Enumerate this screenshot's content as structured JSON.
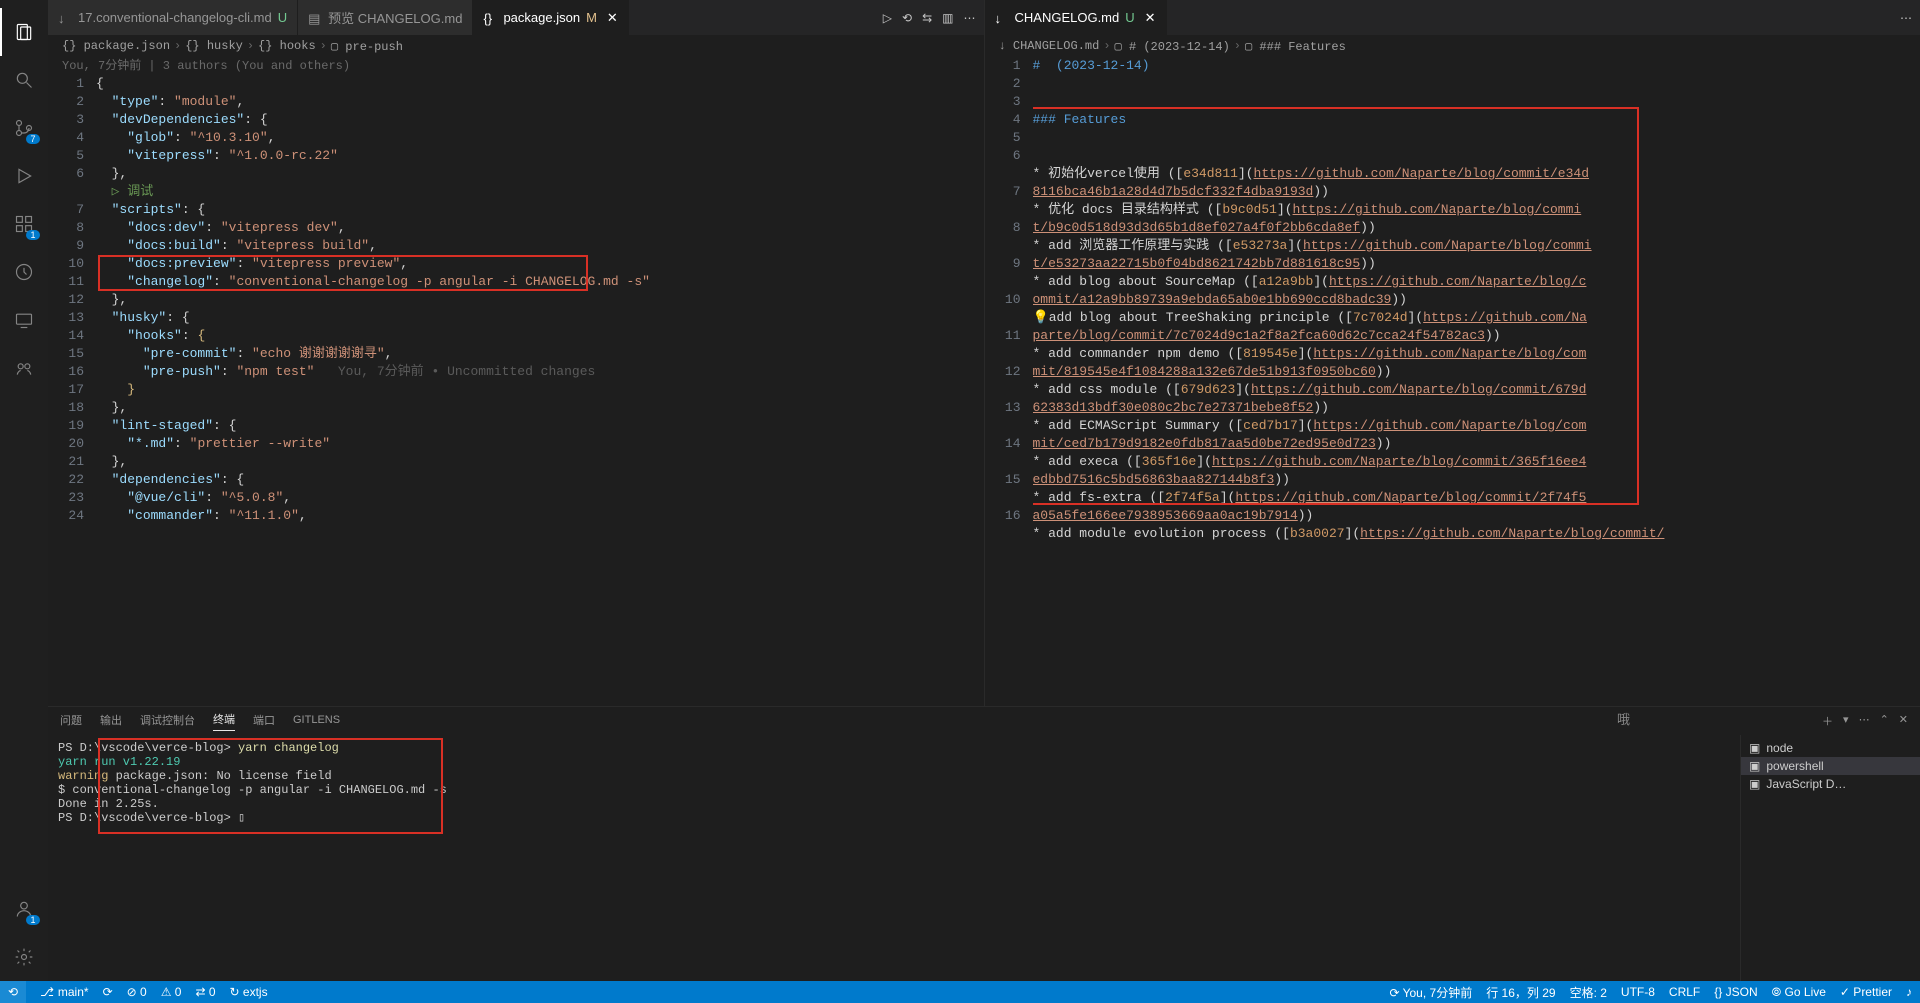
{
  "activity_badges": {
    "scm": "7",
    "extensions": "1",
    "accounts": "1"
  },
  "left_editor": {
    "tabs": [
      {
        "label": "17.conventional-changelog-cli.md",
        "status": "U",
        "icon": "↓"
      },
      {
        "label": "预览 CHANGELOG.md",
        "icon": "▤"
      },
      {
        "label": "package.json",
        "status": "M",
        "icon": "{}",
        "active": true
      }
    ],
    "breadcrumb": [
      "{} package.json",
      "{} husky",
      "{} hooks",
      "▢ pre-push"
    ],
    "blame": "You, 7分钟前 | 3 authors (You and others)",
    "code": [
      {
        "n": 1,
        "html": "<span class='tok-p'>{</span>"
      },
      {
        "n": 2,
        "html": "  <span class='tok-k'>\"type\"</span><span class='tok-p'>: </span><span class='tok-s'>\"module\"</span><span class='tok-p'>,</span>"
      },
      {
        "n": 3,
        "html": "  <span class='tok-k'>\"devDependencies\"</span><span class='tok-p'>: {</span>"
      },
      {
        "n": 4,
        "html": "    <span class='tok-k'>\"glob\"</span><span class='tok-p'>: </span><span class='tok-s'>\"^10.3.10\"</span><span class='tok-p'>,</span>"
      },
      {
        "n": 5,
        "html": "    <span class='tok-k'>\"vitepress\"</span><span class='tok-p'>: </span><span class='tok-s'>\"^1.0.0-rc.22\"</span>"
      },
      {
        "n": 6,
        "html": "  <span class='tok-p'>},</span>"
      },
      {
        "n": "",
        "html": "  <span class='tok-c'>▷ 调试</span>"
      },
      {
        "n": 7,
        "html": "  <span class='tok-k'>\"scripts\"</span><span class='tok-p'>: {</span>"
      },
      {
        "n": 8,
        "html": "    <span class='tok-k'>\"docs:dev\"</span><span class='tok-p'>: </span><span class='tok-s'>\"vitepress dev\"</span><span class='tok-p'>,</span>"
      },
      {
        "n": 9,
        "html": "    <span class='tok-k'>\"docs:build\"</span><span class='tok-p'>: </span><span class='tok-s'>\"vitepress build\"</span><span class='tok-p'>,</span>"
      },
      {
        "n": 10,
        "html": "    <span class='tok-k'>\"docs:preview\"</span><span class='tok-p'>: </span><span class='tok-s'>\"vitepress preview\"</span><span class='tok-p'>,</span>"
      },
      {
        "n": 11,
        "html": "    <span class='tok-k'>\"changelog\"</span><span class='tok-p'>: </span><span class='tok-s'>\"conventional-changelog -p angular -i CHANGELOG.md -s\"</span>"
      },
      {
        "n": 12,
        "html": "  <span class='tok-p'>},</span>"
      },
      {
        "n": 13,
        "html": "  <span class='tok-k'>\"husky\"</span><span class='tok-p'>: {</span>"
      },
      {
        "n": 14,
        "html": "    <span class='tok-k'>\"hooks\"</span><span class='tok-p'>: </span><span class='yellow-brace'>{</span>"
      },
      {
        "n": 15,
        "html": "      <span class='tok-k'>\"pre-commit\"</span><span class='tok-p'>: </span><span class='tok-s'>\"echo 谢谢谢谢谢寻\"</span><span class='tok-p'>,</span>"
      },
      {
        "n": 16,
        "html": "      <span class='tok-k'>\"pre-push\"</span><span class='tok-p'>: </span><span class='tok-s'>\"npm test\"</span>   <span class='inline-blame'>You, 7分钟前 • Uncommitted changes</span>"
      },
      {
        "n": 17,
        "html": "    <span class='yellow-brace'>}</span>"
      },
      {
        "n": 18,
        "html": "  <span class='tok-p'>},</span>"
      },
      {
        "n": 19,
        "html": "  <span class='tok-k'>\"lint-staged\"</span><span class='tok-p'>: {</span>"
      },
      {
        "n": 20,
        "html": "    <span class='tok-k'>\"*.md\"</span><span class='tok-p'>: </span><span class='tok-s'>\"prettier --write\"</span>"
      },
      {
        "n": 21,
        "html": "  <span class='tok-p'>},</span>"
      },
      {
        "n": 22,
        "html": "  <span class='tok-k'>\"dependencies\"</span><span class='tok-p'>: {</span>"
      },
      {
        "n": 23,
        "html": "    <span class='tok-k'>\"@vue/cli\"</span><span class='tok-p'>: </span><span class='tok-s'>\"^5.0.8\"</span><span class='tok-p'>,</span>"
      },
      {
        "n": 24,
        "html": "    <span class='tok-k'>\"commander\"</span><span class='tok-p'>: </span><span class='tok-s'>\"^11.1.0\"</span><span class='tok-p'>,</span>"
      }
    ]
  },
  "right_editor": {
    "tabs": [
      {
        "label": "CHANGELOG.md",
        "status": "U",
        "icon": "↓",
        "active": true
      }
    ],
    "breadcrumb": [
      "↓ CHANGELOG.md",
      "▢ # (2023-12-14)",
      "▢ ### Features"
    ],
    "code": [
      {
        "n": 1,
        "html": "<span class='tok-h'>#  (2023-12-14)</span>"
      },
      {
        "n": 2,
        "html": ""
      },
      {
        "n": 3,
        "html": ""
      },
      {
        "n": 4,
        "html": "<span class='tok-h'>### Features</span>"
      },
      {
        "n": 5,
        "html": ""
      },
      {
        "n": 6,
        "html": "<span class='tok-p'>* 初始化vercel使用 ([</span><span class='tok-hash'>e34d811</span><span class='tok-p'>](</span><span class='tok-link'>https://github.com/Naparte/blog/commit/e34d8116bca46b1a28d4d7b5dcf332f4dba9193d</span><span class='tok-p'>))</span>"
      },
      {
        "n": 7,
        "html": "<span class='tok-p'>* 优化 docs 目录结构样式 ([</span><span class='tok-hash'>b9c0d51</span><span class='tok-p'>](</span><span class='tok-link'>https://github.com/Naparte/blog/commit/b9c0d518d93d3d65b1d8ef027a4f0f2bb6cda8ef</span><span class='tok-p'>))</span>"
      },
      {
        "n": 8,
        "html": "<span class='tok-p'>* add 浏览器工作原理与实践 ([</span><span class='tok-hash'>e53273a</span><span class='tok-p'>](</span><span class='tok-link'>https://github.com/Naparte/blog/commit/e53273aa22715b0f04bd8621742bb7d881618c95</span><span class='tok-p'>))</span>"
      },
      {
        "n": 9,
        "html": "<span class='tok-p'>* add blog about SourceMap ([</span><span class='tok-hash'>a12a9bb</span><span class='tok-p'>](</span><span class='tok-link'>https://github.com/Naparte/blog/commit/a12a9bb89739a9ebda65ab0e1bb690ccd8badc39</span><span class='tok-p'>))</span>"
      },
      {
        "n": 10,
        "html": "💡<span class='tok-p'>add blog about TreeShaking principle ([</span><span class='tok-hash'>7c7024d</span><span class='tok-p'>](</span><span class='tok-link'>https://github.com/Naparte/blog/commit/7c7024d9c1a2f8a2fca60d62c7cca24f54782ac3</span><span class='tok-p'>))</span>"
      },
      {
        "n": 11,
        "html": "<span class='tok-p'>* add commander npm demo ([</span><span class='tok-hash'>819545e</span><span class='tok-p'>](</span><span class='tok-link'>https://github.com/Naparte/blog/commit/819545e4f1084288a132e67de51b913f0950bc60</span><span class='tok-p'>))</span>"
      },
      {
        "n": 12,
        "html": "<span class='tok-p'>* add css module ([</span><span class='tok-hash'>679d623</span><span class='tok-p'>](</span><span class='tok-link'>https://github.com/Naparte/blog/commit/679d62383d13bdf30e080c2bc7e27371bebe8f52</span><span class='tok-p'>))</span>"
      },
      {
        "n": 13,
        "html": "<span class='tok-p'>* add ECMAScript Summary ([</span><span class='tok-hash'>ced7b17</span><span class='tok-p'>](</span><span class='tok-link'>https://github.com/Naparte/blog/commit/ced7b179d9182e0fdb817aa5d0be72ed95e0d723</span><span class='tok-p'>))</span>"
      },
      {
        "n": 14,
        "html": "<span class='tok-p'>* add execa ([</span><span class='tok-hash'>365f16e</span><span class='tok-p'>](</span><span class='tok-link'>https://github.com/Naparte/blog/commit/365f16ee4edbbd7516c5bd56863baa827144b8f3</span><span class='tok-p'>))</span>"
      },
      {
        "n": 15,
        "html": "<span class='tok-p'>* add fs-extra ([</span><span class='tok-hash'>2f74f5a</span><span class='tok-p'>](</span><span class='tok-link'>https://github.com/Naparte/blog/commit/2f74f5a05a5fe166ee7938953669aa0ac19b7914</span><span class='tok-p'>))</span>"
      },
      {
        "n": 16,
        "html": "<span class='tok-p'>* add module evolution process ([</span><span class='tok-hash'>b3a0027</span><span class='tok-p'>](</span><span class='tok-link'>https://github.com/Naparte/blog/commit/</span>"
      }
    ]
  },
  "panel": {
    "tabs": [
      "问题",
      "输出",
      "调试控制台",
      "终端",
      "端口",
      "GITLENS"
    ],
    "active_tab": 3,
    "terminal": [
      {
        "cls": "t-white",
        "text": "PS D:\\vscode\\verce-blog> ",
        "cmd": "yarn changelog"
      },
      {
        "cls": "t-cyan",
        "text": "yarn run v1.22.19"
      },
      {
        "cls": "t-warn",
        "text": "warning",
        "rest": " package.json: No license field"
      },
      {
        "cls": "t-white",
        "text": "$ conventional-changelog -p angular -i CHANGELOG.md -s"
      },
      {
        "cls": "t-white",
        "text": "Done in 2.25s."
      },
      {
        "cls": "t-white",
        "text": "PS D:\\vscode\\verce-blog> ▯"
      }
    ],
    "terminals_list": [
      {
        "icon": "▣",
        "label": "node"
      },
      {
        "icon": "▣",
        "label": "powershell",
        "active": true
      },
      {
        "icon": "▣",
        "label": "JavaScript D…"
      }
    ]
  },
  "status": {
    "remote": "⟲",
    "branch": "main*",
    "sync": "⟳",
    "errors": "⊘ 0",
    "warnings": "⚠ 0",
    "ports": "⇄ 0",
    "extjs": "↻ extjs",
    "right": [
      "⟳ You, 7分钟前",
      "行 16，列 29",
      "空格: 2",
      "UTF-8",
      "CRLF",
      "{} JSON",
      "⦾ Go Live",
      "✓ Prettier",
      "♪"
    ]
  },
  "overlay_text": "哦"
}
